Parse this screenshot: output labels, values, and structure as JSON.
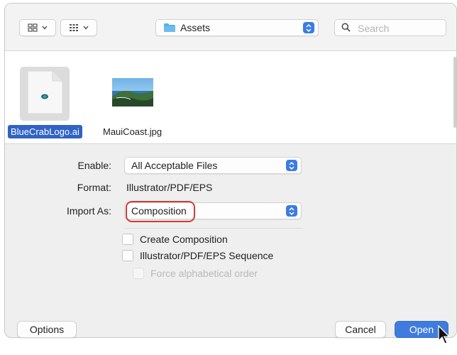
{
  "toolbar": {
    "view_icon": "icon-grid-view-icon",
    "group_icon": "group-by-icon",
    "location_label": "Assets",
    "search_placeholder": "Search"
  },
  "files": [
    {
      "name": "BlueCrabLogo.ai",
      "selected": true,
      "icon": "illustrator-document-icon"
    },
    {
      "name": "MauiCoast.jpg",
      "selected": false,
      "icon": "photo-thumbnail-icon"
    }
  ],
  "form": {
    "enable_label": "Enable:",
    "enable_value": "All Acceptable Files",
    "format_label": "Format:",
    "format_value": "Illustrator/PDF/EPS",
    "import_label": "Import As:",
    "import_value": "Composition",
    "create_composition": "Create Composition",
    "sequence": "Illustrator/PDF/EPS Sequence",
    "force_alpha": "Force alphabetical order"
  },
  "buttons": {
    "options": "Options",
    "cancel": "Cancel",
    "open": "Open"
  },
  "colors": {
    "accent": "#3b7be4",
    "selection": "#2f63c6",
    "highlight_ring": "#d33a3a"
  }
}
